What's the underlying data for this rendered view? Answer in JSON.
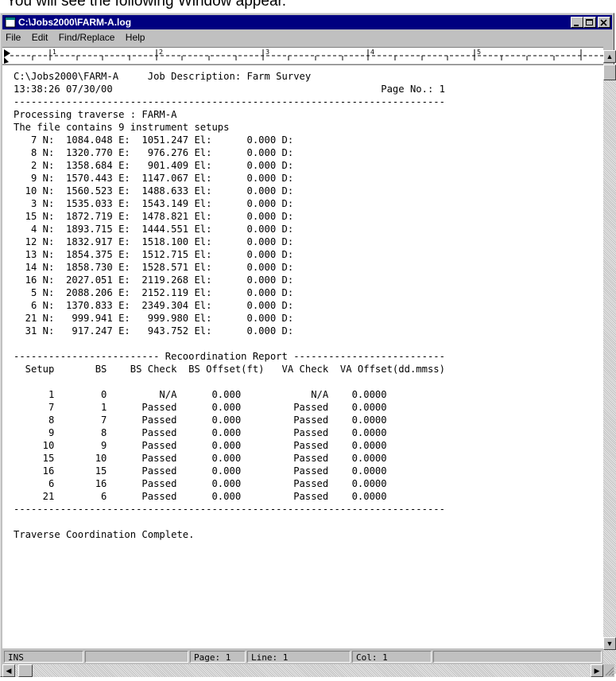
{
  "caption": "You will see the following Window appear.",
  "window": {
    "title": "C:\\Jobs2000\\FARM-A.log"
  },
  "menu": [
    "File",
    "Edit",
    "Find/Replace",
    "Help"
  ],
  "ruler_labels": [
    "1",
    "2",
    "3",
    "4",
    "5"
  ],
  "document": {
    "lines": [
      "C:\\Jobs2000\\FARM-A     Job Description: Farm Survey",
      "13:38:26 07/30/00                                              Page No.: 1",
      "--------------------------------------------------------------------------",
      "Processing traverse : FARM-A",
      "The file contains 9 instrument setups",
      "   7 N:  1084.048 E:  1051.247 El:      0.000 D:",
      "   8 N:  1320.770 E:   976.276 El:      0.000 D:",
      "   2 N:  1358.684 E:   901.409 El:      0.000 D:",
      "   9 N:  1570.443 E:  1147.067 El:      0.000 D:",
      "  10 N:  1560.523 E:  1488.633 El:      0.000 D:",
      "   3 N:  1535.033 E:  1543.149 El:      0.000 D:",
      "  15 N:  1872.719 E:  1478.821 El:      0.000 D:",
      "   4 N:  1893.715 E:  1444.551 El:      0.000 D:",
      "  12 N:  1832.917 E:  1518.100 El:      0.000 D:",
      "  13 N:  1854.375 E:  1512.715 El:      0.000 D:",
      "  14 N:  1858.730 E:  1528.571 El:      0.000 D:",
      "  16 N:  2027.051 E:  2119.268 El:      0.000 D:",
      "   5 N:  2088.206 E:  2152.119 El:      0.000 D:",
      "   6 N:  1370.833 E:  2349.304 El:      0.000 D:",
      "  21 N:   999.941 E:   999.980 El:      0.000 D:",
      "  31 N:   917.247 E:   943.752 El:      0.000 D:",
      "",
      "------------------------- Recoordination Report --------------------------",
      "  Setup       BS    BS Check  BS Offset(ft)   VA Check  VA Offset(dd.mmss)",
      "",
      "      1        0         N/A      0.000            N/A    0.0000",
      "      7        1      Passed      0.000         Passed    0.0000",
      "      8        7      Passed      0.000         Passed    0.0000",
      "      9        8      Passed      0.000         Passed    0.0000",
      "     10        9      Passed      0.000         Passed    0.0000",
      "     15       10      Passed      0.000         Passed    0.0000",
      "     16       15      Passed      0.000         Passed    0.0000",
      "      6       16      Passed      0.000         Passed    0.0000",
      "     21        6      Passed      0.000         Passed    0.0000",
      "--------------------------------------------------------------------------",
      "",
      "Traverse Coordination Complete."
    ]
  },
  "status": {
    "mode": "INS",
    "page": "Page: 1",
    "line": "Line: 1",
    "col": "Col: 1"
  }
}
